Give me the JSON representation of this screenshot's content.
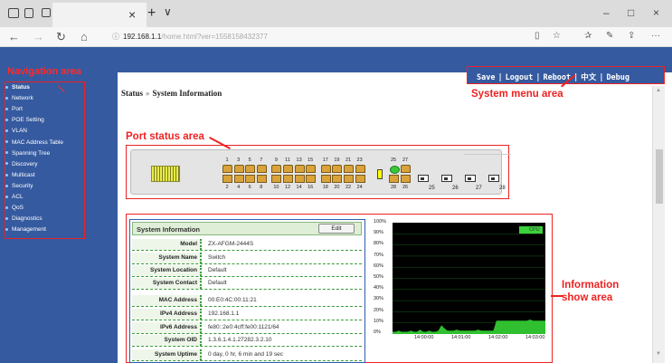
{
  "browser": {
    "tab_close": "×",
    "new_tab": "+",
    "tab_menu": "∨",
    "win_min": "–",
    "win_max": "□",
    "win_close": "×",
    "back": "←",
    "forward": "→",
    "refresh": "↻",
    "home": "⌂",
    "url_host": "192.168.1.1",
    "url_path": "/home.html?ver=1558158432377",
    "reading_icon": "reading-view-icon",
    "favorite_icon": "star-icon",
    "more": "···"
  },
  "annotations": {
    "navigation_area": "Navigation area",
    "system_menu_area": "System menu area",
    "port_status_area": "Port status area",
    "information_show_area": [
      "Information",
      "show area"
    ]
  },
  "sidebar": {
    "items": [
      {
        "label": "Status",
        "active": true
      },
      {
        "label": "Network"
      },
      {
        "label": "Port"
      },
      {
        "label": "POE Setting"
      },
      {
        "label": "VLAN"
      },
      {
        "label": "MAC Address Table"
      },
      {
        "label": "Spanning Tree"
      },
      {
        "label": "Discovery"
      },
      {
        "label": "Multicast"
      },
      {
        "label": "Security"
      },
      {
        "label": "ACL"
      },
      {
        "label": "QoS"
      },
      {
        "label": "Diagnostics"
      },
      {
        "label": "Management"
      }
    ]
  },
  "system_menu": {
    "save": "Save",
    "logout": "Logout",
    "reboot": "Reboot",
    "language": "中文",
    "debug": "Debug",
    "separator": "|"
  },
  "breadcrumb": {
    "section": "Status",
    "separator": "»",
    "page": "System Information"
  },
  "ports": {
    "top_numbers": [
      "1",
      "3",
      "5",
      "7",
      "9",
      "11",
      "13",
      "15",
      "17",
      "19",
      "21",
      "23"
    ],
    "bottom_numbers": [
      "2",
      "4",
      "6",
      "8",
      "10",
      "12",
      "14",
      "16",
      "18",
      "20",
      "22",
      "24"
    ],
    "combo_top": [
      "25",
      "27"
    ],
    "combo_bottom": [
      "28",
      "26"
    ],
    "sfp": [
      "25",
      "26",
      "27",
      "28"
    ],
    "active_port": "25"
  },
  "system_info": {
    "title": "System Information",
    "edit_label": "Edit",
    "rows": [
      {
        "label": "Model",
        "value": "ZX-AFGM-2444S"
      },
      {
        "label": "System Name",
        "value": "Switch"
      },
      {
        "label": "System Location",
        "value": "Default"
      },
      {
        "label": "System Contact",
        "value": "Default"
      },
      {
        "label": "MAC Address",
        "value": "00:E0:4C:00:11:21"
      },
      {
        "label": "IPv4 Address",
        "value": "192.168.1.1"
      },
      {
        "label": "IPv6 Address",
        "value": "fe80::2e0:4cff:fe00:1121/64"
      },
      {
        "label": "System OID",
        "value": "1.3.6.1.4.1.27282.3.2.10"
      },
      {
        "label": "System Uptime",
        "value": "0 day, 0 hr, 6 min and 19 sec"
      }
    ]
  },
  "cpu_graph": {
    "legend": "CPU",
    "y_ticks": [
      "100%",
      "90%",
      "80%",
      "70%",
      "60%",
      "50%",
      "40%",
      "30%",
      "20%",
      "10%",
      "0%"
    ],
    "x_ticks": [
      "14:00:00",
      "14:01:00",
      "14:02:00",
      "14:03:00"
    ],
    "cpu_series_percent": [
      2,
      2,
      3,
      2,
      2,
      2,
      3,
      2,
      2,
      4,
      2,
      2,
      3,
      2,
      2,
      3,
      8,
      5,
      3,
      3,
      3,
      4,
      3,
      3,
      3,
      3,
      3,
      3,
      4,
      3,
      3,
      3,
      3,
      3,
      12,
      12,
      12,
      12,
      12,
      12,
      12,
      12,
      12,
      12,
      12,
      13,
      12,
      12,
      12,
      12,
      12
    ]
  }
}
